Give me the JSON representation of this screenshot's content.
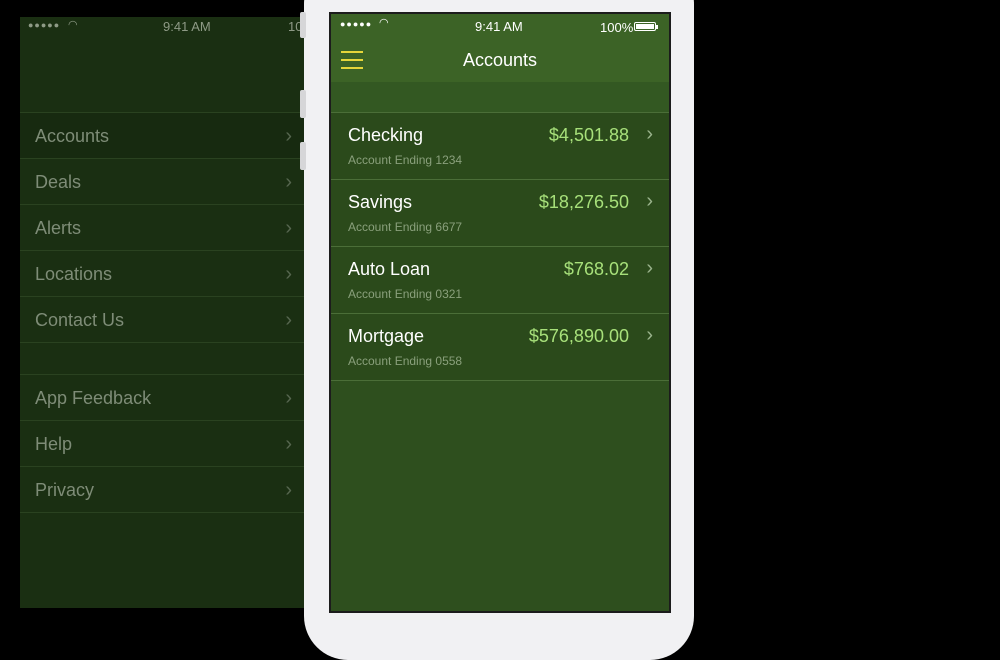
{
  "menu": {
    "status": {
      "time": "9:41 AM",
      "battery": "10"
    },
    "items": [
      {
        "label": "Accounts"
      },
      {
        "label": "Deals"
      },
      {
        "label": "Alerts"
      },
      {
        "label": "Locations"
      },
      {
        "label": "Contact Us"
      }
    ],
    "secondary_items": [
      {
        "label": "App Feedback"
      },
      {
        "label": "Help"
      },
      {
        "label": "Privacy"
      }
    ]
  },
  "status_bar": {
    "time": "9:41 AM",
    "battery": "100%"
  },
  "header": {
    "title": "Accounts"
  },
  "colors": {
    "accent": "#e6d63a",
    "balance": "#a7e07a",
    "background": "#2e4f1e"
  },
  "accounts": [
    {
      "name": "Checking",
      "subtitle": "Account Ending 1234",
      "balance": "$4,501.88"
    },
    {
      "name": "Savings",
      "subtitle": "Account Ending 6677",
      "balance": "$18,276.50"
    },
    {
      "name": "Auto Loan",
      "subtitle": "Account Ending 0321",
      "balance": "$768.02"
    },
    {
      "name": "Mortgage",
      "subtitle": "Account Ending 0558",
      "balance": "$576,890.00"
    }
  ]
}
